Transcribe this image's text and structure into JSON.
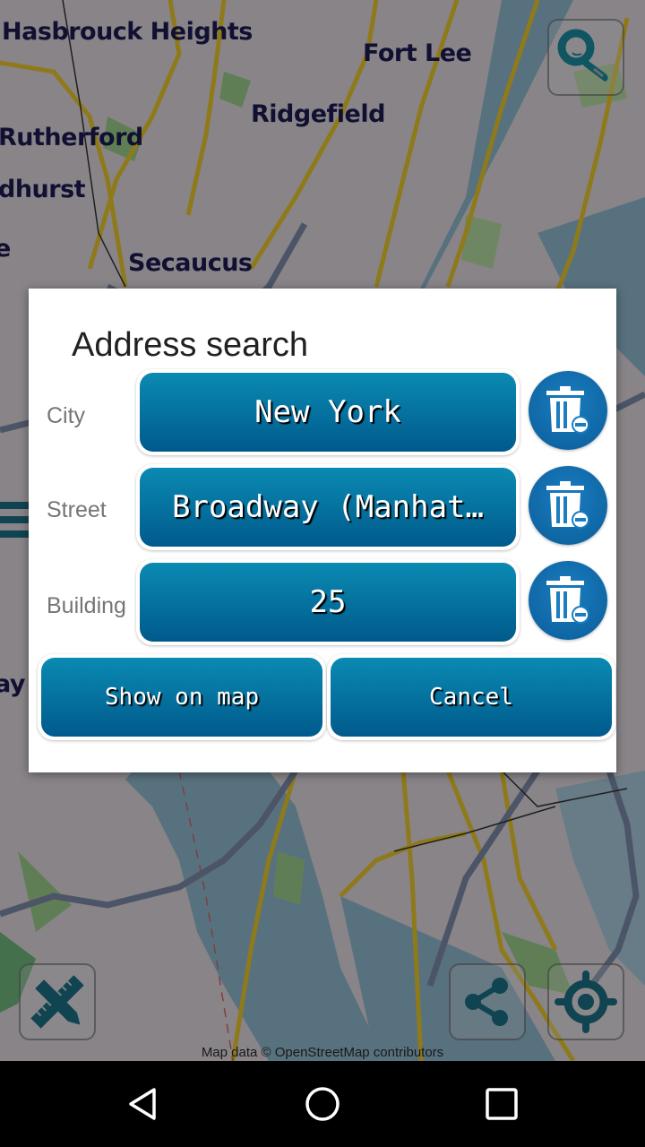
{
  "map": {
    "labels": {
      "hasbrouck": "Hasbrouck Heights",
      "fortlee": "Fort Lee",
      "ridgefield": "Ridgefield",
      "rutherford": "Rutherford",
      "lyndhurst": "dhurst",
      "secaucus": "Secaucus",
      "bayonne": "ay",
      "edge_e": "e"
    },
    "attribution": "Map data © OpenStreetMap contributors",
    "controls": {
      "search": "search-icon",
      "measure": "ruler-pencil-icon",
      "share": "share-icon",
      "locate": "locate-icon"
    }
  },
  "dialog": {
    "title": "Address search",
    "fields": [
      {
        "label": "City",
        "value": "New York"
      },
      {
        "label": "Street",
        "value": "Broadway (Manhat…"
      },
      {
        "label": "Building",
        "value": "25"
      }
    ],
    "buttons": {
      "show_on_map": "Show on map",
      "cancel": "Cancel"
    },
    "clear_icon": "trash-minus-icon"
  },
  "colors": {
    "button_top": "#0a8ab2",
    "button_bottom": "#005a8c",
    "trash_bg": "#1a7dc0",
    "map_icon": "#1b6f83",
    "city_label": "#1c1b52"
  },
  "navbar": {
    "back": "back-icon",
    "home": "home-icon",
    "recents": "recents-icon"
  }
}
